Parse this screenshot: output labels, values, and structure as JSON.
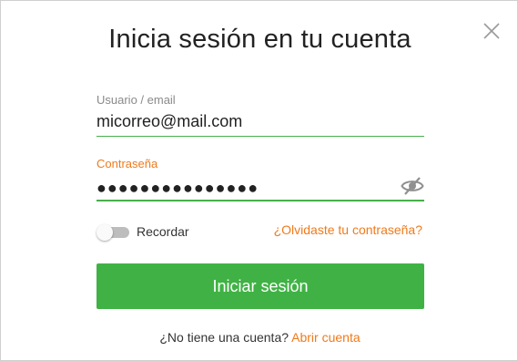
{
  "dialog": {
    "title": "Inicia sesión en tu cuenta",
    "close_icon": "close-icon"
  },
  "username": {
    "label": "Usuario / email",
    "value": "micorreo@mail.com"
  },
  "password": {
    "label": "Contraseña",
    "masked_value": "●●●●●●●●●●●●●●●",
    "visibility_icon": "eye-slash-icon"
  },
  "remember": {
    "label": "Recordar",
    "checked": false
  },
  "forgot_link": "¿Olvidaste tu contraseña?",
  "login_button": "Iniciar sesión",
  "signup": {
    "prompt": "¿No tiene una cuenta?",
    "link": "Abrir cuenta"
  },
  "colors": {
    "accent_orange": "#f07a1a",
    "accent_green": "#40b245",
    "label_gray": "#8a8a8a"
  }
}
